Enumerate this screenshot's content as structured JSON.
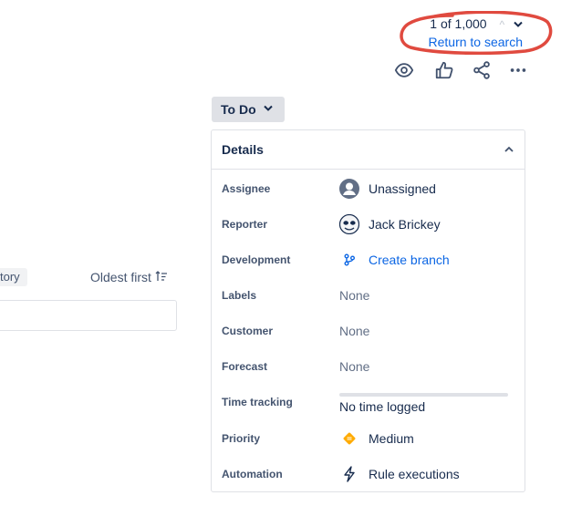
{
  "pager": {
    "count_text": "1 of 1,000",
    "prev_icon": "chevron-up-icon",
    "next_icon": "chevron-down-icon",
    "return_link": "Return to search",
    "annotation_color": "#e04a3f"
  },
  "toolbar": {
    "icons": [
      "eye-icon",
      "thumbs-up-icon",
      "share-icon",
      "more-icon"
    ]
  },
  "status": {
    "label": "To Do",
    "icon": "chevron-down-icon"
  },
  "details": {
    "title": "Details",
    "collapse_icon": "chevron-up-icon",
    "fields": [
      {
        "label": "Assignee",
        "value": "Unassigned",
        "icon": "avatar-placeholder-icon"
      },
      {
        "label": "Reporter",
        "value": "Jack Brickey",
        "icon": "avatar-icon"
      },
      {
        "label": "Development",
        "value": "Create branch",
        "icon": "branch-icon"
      },
      {
        "label": "Labels",
        "value": "None"
      },
      {
        "label": "Customer",
        "value": "None"
      },
      {
        "label": "Forecast",
        "value": "None"
      },
      {
        "label": "Time tracking",
        "value": "No time logged",
        "progress": 0
      },
      {
        "label": "Priority",
        "value": "Medium",
        "icon": "priority-medium-icon",
        "color": "#ffab00"
      },
      {
        "label": "Automation",
        "value": "Rule executions",
        "icon": "lightning-icon"
      }
    ]
  },
  "activity": {
    "history_tab": "tory",
    "sort_label": "Oldest first",
    "sort_icon": "sort-icon"
  },
  "colors": {
    "link": "#0c66e4",
    "text": "#172b4d",
    "muted": "#626f86",
    "border": "#dfe1e6"
  }
}
